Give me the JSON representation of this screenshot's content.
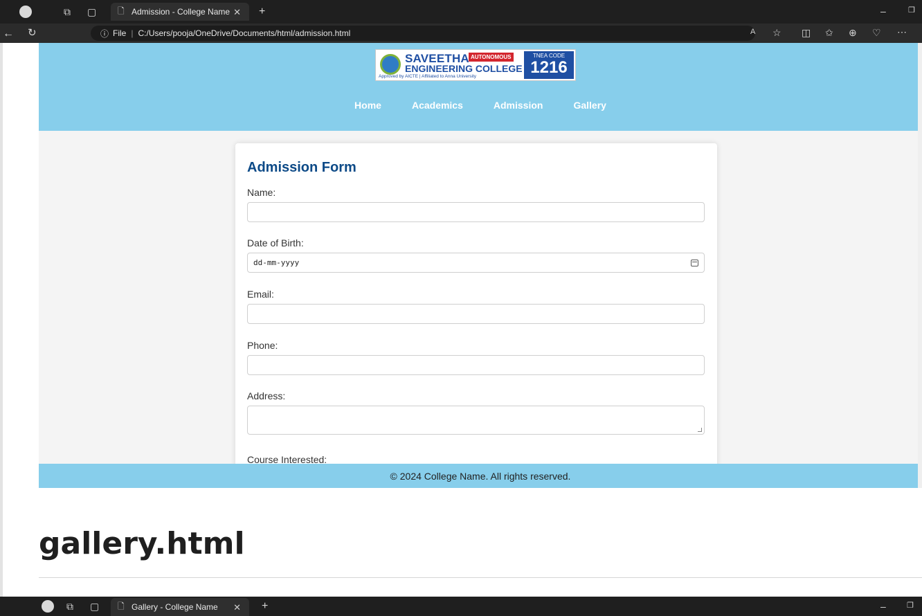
{
  "browser": {
    "tab_title": "Admission - College Name",
    "file_label": "File",
    "url": "C:/Users/pooja/OneDrive/Documents/html/admission.html"
  },
  "site": {
    "logo": {
      "line1": "SAVEETHA",
      "badge": "AUTONOMOUS",
      "line2": "ENGINEERING COLLEGE",
      "line3": "Approved by AICTE | Affiliated to Anna University",
      "tnea_label": "TNEA CODE",
      "tnea_code": "1216"
    },
    "nav": [
      "Home",
      "Academics",
      "Admission",
      "Gallery"
    ],
    "form": {
      "title": "Admission Form",
      "name_label": "Name:",
      "dob_label": "Date of Birth:",
      "dob_placeholder": "dd-mm-yyyy",
      "email_label": "Email:",
      "phone_label": "Phone:",
      "address_label": "Address:",
      "course_label": "Course Interested:"
    },
    "footer": "© 2024 College Name. All rights reserved."
  },
  "doc": {
    "heading": "gallery.html"
  },
  "browser2": {
    "tab_title": "Gallery - College Name"
  }
}
